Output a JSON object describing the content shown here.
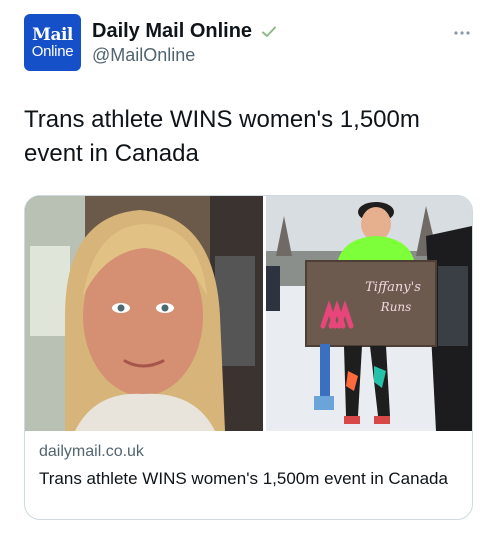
{
  "account": {
    "avatar_line1": "Mail",
    "avatar_line2": "Online",
    "display_name": "Daily Mail Online",
    "handle": "@MailOnline",
    "verified_color": "#1d9bf0"
  },
  "tweet": {
    "text": "Trans athlete WINS women's 1,500m event in Canada"
  },
  "card": {
    "domain": "dailymail.co.uk",
    "title": "Trans athlete WINS women's 1,500m event in Canada",
    "sign_text_line1": "Tiffany's",
    "sign_text_line2": "Runs"
  },
  "colors": {
    "brand": "#1550c8",
    "secondary_text": "#536471",
    "border": "#cfd9de",
    "sign_accent": "#e8457a"
  },
  "icons": {
    "verified": "verified-check-icon",
    "more": "more-dots-icon"
  }
}
